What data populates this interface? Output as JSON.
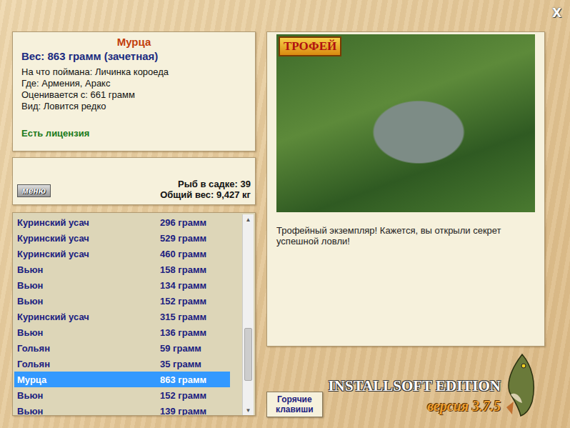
{
  "window": {
    "close": "X"
  },
  "fish": {
    "name": "Мурца",
    "weight": "Вес: 863 грамм (зачетная)",
    "details": [
      "На что поймана: Личинка короеда",
      "Где: Армения, Аракс",
      "Оценивается с: 661 грамм",
      "Вид: Ловится редко"
    ],
    "license": "Есть лицензия"
  },
  "keepnet": {
    "menu_button": "меню",
    "count": "Рыб в садке: 39",
    "total": "Общий вес: 9,427 кг"
  },
  "catch_list": {
    "scroll_position": 0.8,
    "rows": [
      {
        "name": "Куринский усач",
        "weight": "296 грамм",
        "selected": false
      },
      {
        "name": "Куринский усач",
        "weight": "529 грамм",
        "selected": false
      },
      {
        "name": "Куринский усач",
        "weight": "460 грамм",
        "selected": false
      },
      {
        "name": "Вьюн",
        "weight": "158 грамм",
        "selected": false
      },
      {
        "name": "Вьюн",
        "weight": "134 грамм",
        "selected": false
      },
      {
        "name": "Вьюн",
        "weight": "152 грамм",
        "selected": false
      },
      {
        "name": "Куринский усач",
        "weight": "315 грамм",
        "selected": false
      },
      {
        "name": "Вьюн",
        "weight": "136 грамм",
        "selected": false
      },
      {
        "name": "Гольян",
        "weight": "59 грамм",
        "selected": false
      },
      {
        "name": "Гольян",
        "weight": "35 грамм",
        "selected": false
      },
      {
        "name": "Мурца",
        "weight": "863 грамм",
        "selected": true
      },
      {
        "name": "Вьюн",
        "weight": "152 грамм",
        "selected": false
      },
      {
        "name": "Вьюн",
        "weight": "139 грамм",
        "selected": false
      }
    ]
  },
  "photo": {
    "badge": "ТРОФЕЙ",
    "caption": "Трофейный экземпляр! Кажется, вы открыли секрет успешной ловли!"
  },
  "hotkeys_button": "Горячие клавиши",
  "logo": {
    "title": "INSTALLSOFT EDITION",
    "version": "версия 3.7.5"
  }
}
